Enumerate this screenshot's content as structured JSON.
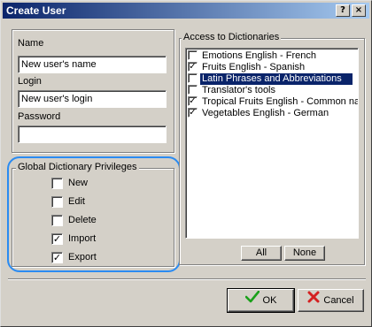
{
  "window": {
    "title": "Create User",
    "help_glyph": "?",
    "close_glyph": "×"
  },
  "user_fields": {
    "name_label": "Name",
    "name_value": "New user's name",
    "login_label": "Login",
    "login_value": "New user's login",
    "password_label": "Password",
    "password_value": ""
  },
  "privileges": {
    "title": "Global Dictionary Privileges",
    "items": [
      {
        "label": "New",
        "checked": false
      },
      {
        "label": "Edit",
        "checked": false
      },
      {
        "label": "Delete",
        "checked": false
      },
      {
        "label": "Import",
        "checked": true
      },
      {
        "label": "Export",
        "checked": true
      }
    ]
  },
  "dictionaries": {
    "title": "Access to Dictionaries",
    "items": [
      {
        "label": "Emotions English - French",
        "checked": false,
        "selected": false
      },
      {
        "label": "Fruits English - Spanish",
        "checked": true,
        "selected": false
      },
      {
        "label": "Latin Phrases and Abbreviations",
        "checked": false,
        "selected": true
      },
      {
        "label": "Translator's tools",
        "checked": false,
        "selected": false
      },
      {
        "label": "Tropical Fruits English - Common nar",
        "checked": true,
        "selected": false
      },
      {
        "label": "Vegetables English - German",
        "checked": true,
        "selected": false
      }
    ],
    "all_label": "All",
    "none_label": "None"
  },
  "actions": {
    "ok_label": "OK",
    "cancel_label": "Cancel"
  },
  "icons": {
    "ok": "green-checkmark-icon",
    "cancel": "red-x-icon"
  },
  "colors": {
    "selection": "#0a246a",
    "highlight_ring": "#2a8bf2",
    "ok_icon": "#1aa01a",
    "cancel_icon": "#d42020"
  }
}
